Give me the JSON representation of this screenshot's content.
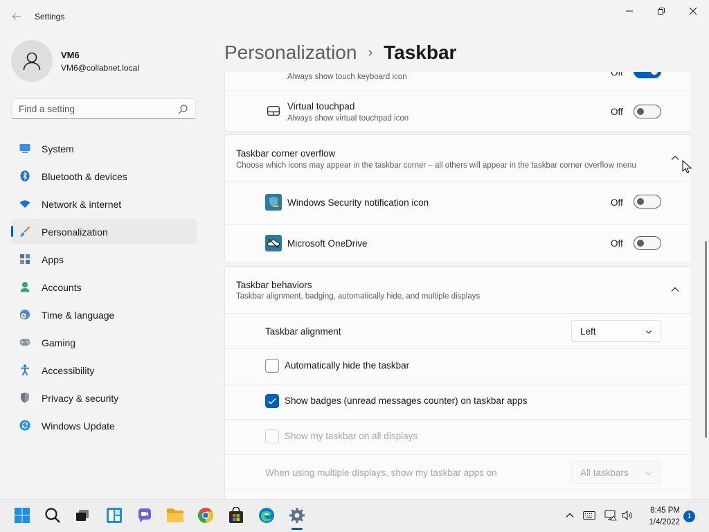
{
  "window": {
    "title": "Settings"
  },
  "user": {
    "name": "VM6",
    "email": "VM6@collabnet.local"
  },
  "search": {
    "placeholder": "Find a setting"
  },
  "sidebar": {
    "items": [
      {
        "label": "System",
        "icon": "system-icon",
        "active": false
      },
      {
        "label": "Bluetooth & devices",
        "icon": "bluetooth-icon",
        "active": false
      },
      {
        "label": "Network & internet",
        "icon": "wifi-icon",
        "active": false
      },
      {
        "label": "Personalization",
        "icon": "brush-icon",
        "active": true
      },
      {
        "label": "Apps",
        "icon": "apps-icon",
        "active": false
      },
      {
        "label": "Accounts",
        "icon": "accounts-icon",
        "active": false
      },
      {
        "label": "Time & language",
        "icon": "clock-globe-icon",
        "active": false
      },
      {
        "label": "Gaming",
        "icon": "gamepad-icon",
        "active": false
      },
      {
        "label": "Accessibility",
        "icon": "accessibility-icon",
        "active": false
      },
      {
        "label": "Privacy & security",
        "icon": "shield-icon",
        "active": false
      },
      {
        "label": "Windows Update",
        "icon": "update-icon",
        "active": false
      }
    ]
  },
  "breadcrumb": {
    "parent": "Personalization",
    "separator": "›",
    "current": "Taskbar"
  },
  "content": {
    "touch_keyboard": {
      "desc": "Always show touch keyboard icon",
      "state": "Off",
      "on": true
    },
    "virtual_touchpad": {
      "title": "Virtual touchpad",
      "desc": "Always show virtual touchpad icon",
      "state": "Off",
      "on": false
    },
    "corner_overflow": {
      "title": "Taskbar corner overflow",
      "desc": "Choose which icons may appear in the taskbar corner – all others will appear in the taskbar corner overflow menu",
      "items": [
        {
          "label": "Windows Security notification icon",
          "state": "Off",
          "on": false
        },
        {
          "label": "Microsoft OneDrive",
          "state": "Off",
          "on": false
        }
      ]
    },
    "behaviors": {
      "title": "Taskbar behaviors",
      "desc": "Taskbar alignment, badging, automatically hide, and multiple displays",
      "alignment_label": "Taskbar alignment",
      "alignment_value": "Left",
      "auto_hide": {
        "label": "Automatically hide the taskbar",
        "checked": false
      },
      "badges": {
        "label": "Show badges (unread messages counter) on taskbar apps",
        "checked": true
      },
      "all_displays": {
        "label": "Show my taskbar on all displays",
        "checked": false,
        "disabled": true
      },
      "multi_display": {
        "label": "When using multiple displays, show my taskbar apps on",
        "value": "All taskbars",
        "disabled": true
      }
    }
  },
  "taskbar": {
    "time": "8:45 PM",
    "date": "1/4/2022",
    "notification_count": "1"
  },
  "colors": {
    "accent": "#005fb8"
  }
}
